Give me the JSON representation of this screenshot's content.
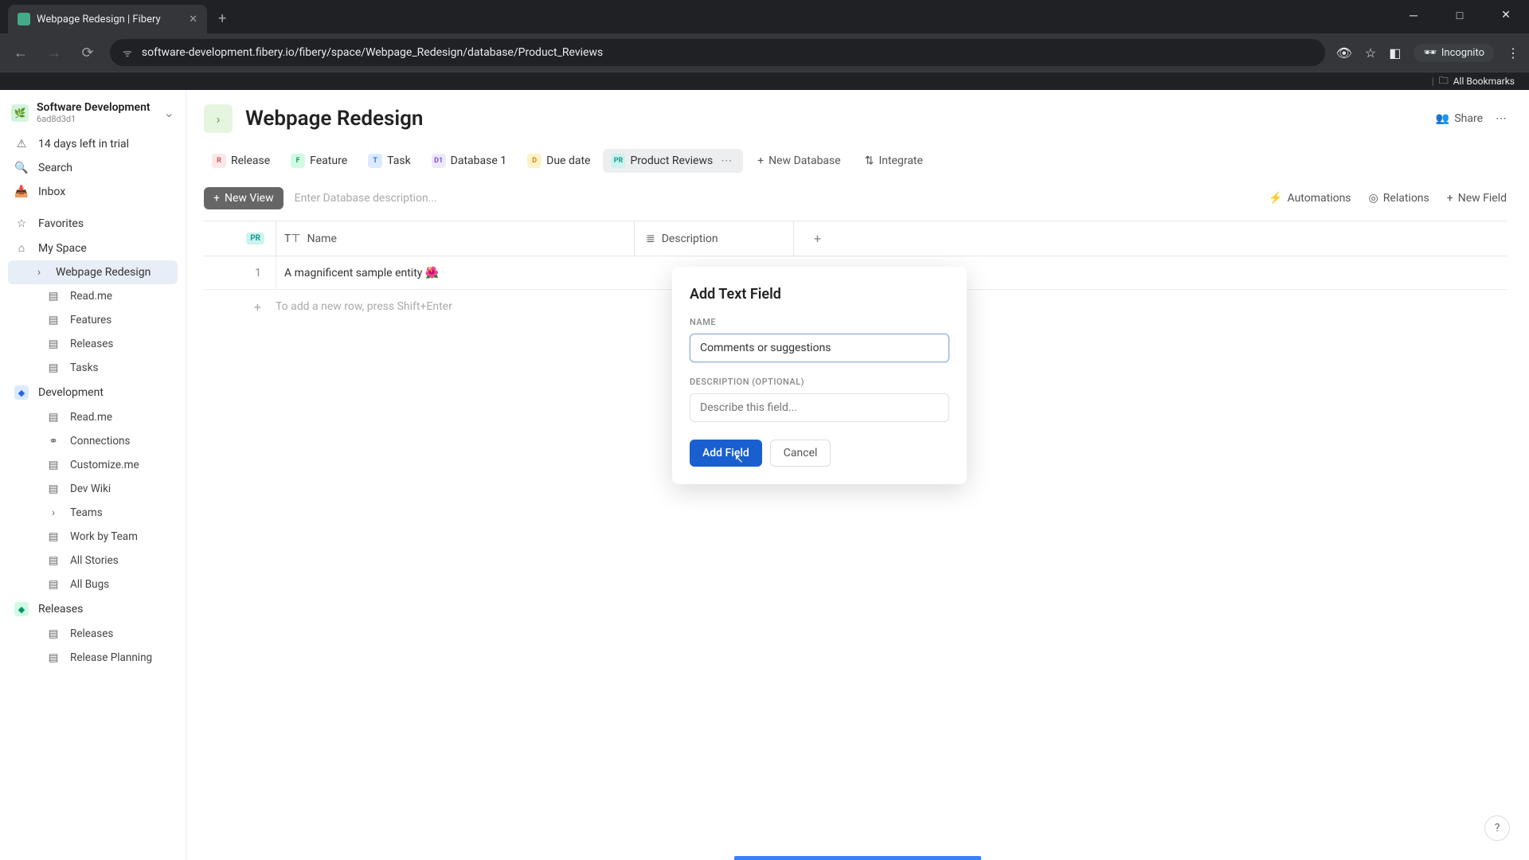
{
  "browser": {
    "tab_title": "Webpage Redesign | Fibery",
    "url": "software-development.fibery.io/fibery/space/Webpage_Redesign/database/Product_Reviews",
    "incognito": "Incognito",
    "bookmarks": "All Bookmarks"
  },
  "workspace": {
    "name": "Software Development",
    "id": "6ad8d3d1",
    "trial": "14 days left in trial"
  },
  "sidebar": {
    "search": "Search",
    "inbox": "Inbox",
    "favorites": "Favorites",
    "my_space": "My Space",
    "webpage_redesign": "Webpage Redesign",
    "items_wr": [
      "Read.me",
      "Features",
      "Releases",
      "Tasks"
    ],
    "development": "Development",
    "items_dev": [
      "Read.me",
      "Connections",
      "Customize.me",
      "Dev Wiki",
      "Teams",
      "Work by Team",
      "All Stories",
      "All Bugs"
    ],
    "releases": "Releases",
    "items_rel": [
      "Releases",
      "Release Planning"
    ]
  },
  "page": {
    "title": "Webpage Redesign",
    "share": "Share"
  },
  "tabs": {
    "release": "Release",
    "feature": "Feature",
    "task": "Task",
    "db1": "Database 1",
    "due": "Due date",
    "pr": "Product Reviews",
    "new_db": "New Database",
    "integrate": "Integrate"
  },
  "toolbar": {
    "new_view": "New View",
    "desc_placeholder": "Enter Database description...",
    "automations": "Automations",
    "relations": "Relations",
    "new_field": "New Field"
  },
  "table": {
    "col_name": "Name",
    "col_desc": "Description",
    "row1_num": "1",
    "row1_name": "A magnificent sample entity 🌺",
    "addrow": "To add a new row, press Shift+Enter"
  },
  "modal": {
    "title": "Add Text Field",
    "name_label": "NAME",
    "name_value": "Comments or suggestions",
    "desc_label": "DESCRIPTION (OPTIONAL)",
    "desc_placeholder": "Describe this field...",
    "add": "Add Field",
    "cancel": "Cancel"
  },
  "help": "?"
}
